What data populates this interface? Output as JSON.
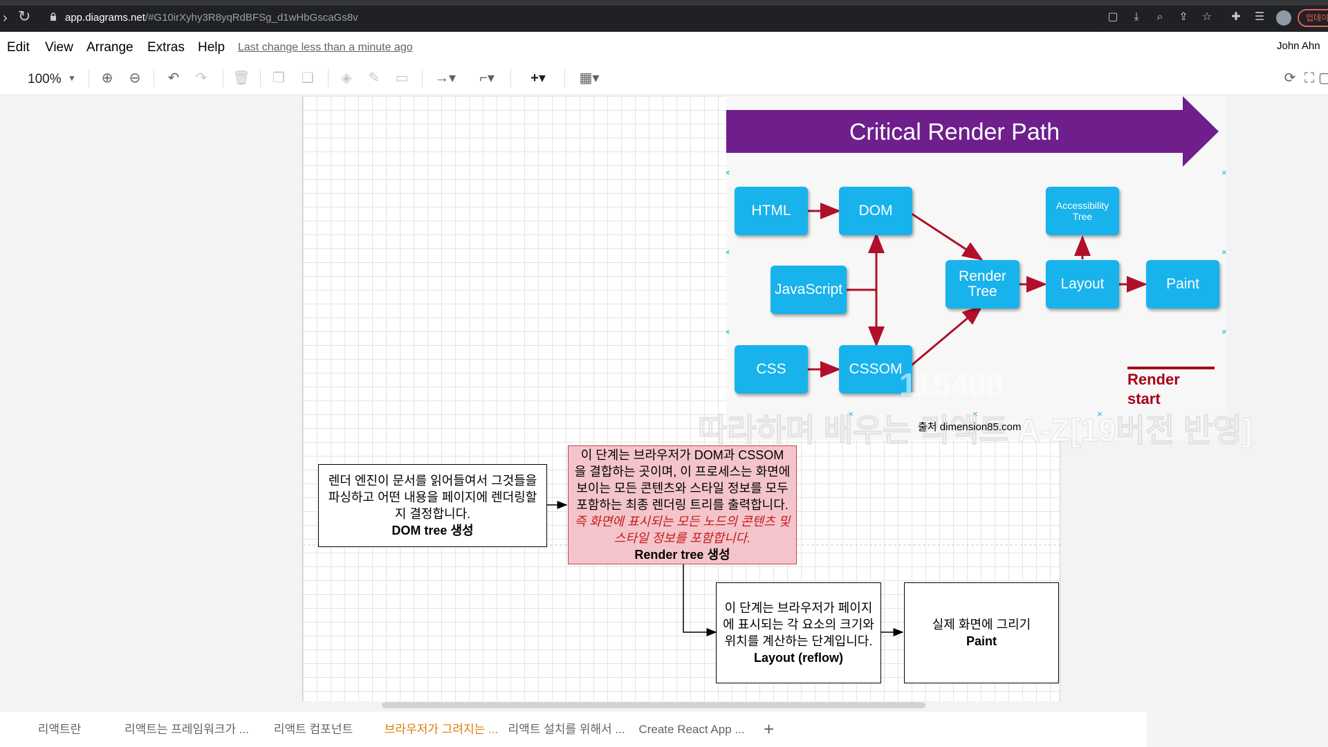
{
  "browser": {
    "url_host": "app.diagrams.net",
    "url_path": "/#G10irXyhy3R8yqRdBFSg_d1wHbGscaGs8v",
    "update_label": "업데이"
  },
  "menu": {
    "items": [
      "Edit",
      "View",
      "Arrange",
      "Extras",
      "Help"
    ],
    "last_change": "Last change less than a minute ago",
    "user": "John Ahn"
  },
  "toolbar": {
    "zoom": "100%"
  },
  "diagram": {
    "banner_title": "Critical Render Path",
    "nodes": {
      "html": "HTML",
      "dom": "DOM",
      "javascript": "JavaScript",
      "css": "CSS",
      "cssom": "CSSOM",
      "render_tree_1": "Render",
      "render_tree_2": "Tree",
      "layout": "Layout",
      "paint": "Paint",
      "accessibility_1": "Accessibility",
      "accessibility_2": "Tree"
    },
    "render_start_1": "Render",
    "render_start_2": "start",
    "source_caption": "출처  dimension85.com",
    "watermark_code": "115408",
    "watermark_text": "따라하며 배우는 리액트 A-Z[19버전 반영]"
  },
  "notes": {
    "dom": {
      "line1": "렌더 엔진이 문서를 읽어들여서 그것들을",
      "line2": "파싱하고 어떤 내용을 페이지에 렌더링할",
      "line3": "지 결정합니다.",
      "title": "DOM tree 생성"
    },
    "render": {
      "line1": "이 단계는 브라우저가 DOM과 CSSOM",
      "line2": "을 결합하는 곳이며, 이 프로세스는 화면에",
      "line3": "보이는 모든 콘텐츠와 스타일 정보를 모두",
      "line4": "포함하는 최종 렌더링 트리를 출력합니다.",
      "em1": "즉 화면에 표시되는 모든 노드의 콘텐츠 및",
      "em2": "스타일 정보를 포함합니다.",
      "title": "Render tree 생성"
    },
    "layout": {
      "line1": "이 단계는 브라우저가 페이지",
      "line2": "에 표시되는 각 요소의 크기와",
      "line3": "위치를 계산하는 단계입니다.",
      "title": "Layout (reflow)"
    },
    "paint": {
      "line1": "실제 화면에 그리기",
      "title": "Paint"
    }
  },
  "page_tabs": {
    "tabs": [
      "리액트란",
      "리액트는 프레임워크가 ...",
      "리액트 컴포넌트",
      "브라우저가 그려지는 ...",
      "리액트 설치를 위해서 ...",
      "Create React App ..."
    ],
    "active_index": 3,
    "add_label": "+"
  },
  "colors": {
    "banner": "#6e1f8c",
    "node": "#18b2ec",
    "arrow": "#b0102a",
    "render_note_bg": "#f4c4cb",
    "active_tab": "#e07b00"
  }
}
